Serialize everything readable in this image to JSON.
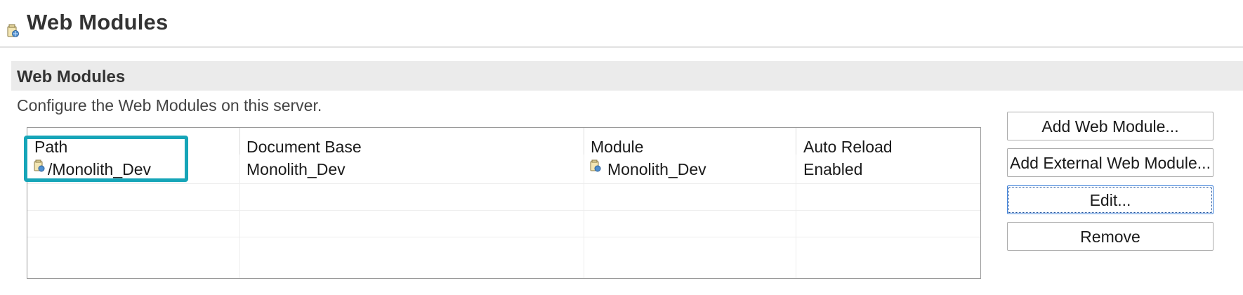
{
  "page": {
    "title": "Web Modules",
    "title_icon": "web-module-icon"
  },
  "section": {
    "title": "Web Modules",
    "description": "Configure the Web Modules on this server."
  },
  "table": {
    "columns": [
      "Path",
      "Document Base",
      "Module",
      "Auto Reload"
    ],
    "rows": [
      {
        "path": "/Monolith_Dev",
        "path_icon": "web-module-icon",
        "document_base": "Monolith_Dev",
        "module": "Monolith_Dev",
        "module_icon": "web-module-icon",
        "auto_reload": "Enabled",
        "highlighted": true
      }
    ]
  },
  "buttons": {
    "add_web_module": "Add Web Module...",
    "add_external_web_module": "Add External Web Module...",
    "edit": "Edit...",
    "remove": "Remove"
  },
  "colors": {
    "highlight": "#16a5b8",
    "section_header_bg": "#ebebeb",
    "focus_border": "#3c7fd8"
  }
}
